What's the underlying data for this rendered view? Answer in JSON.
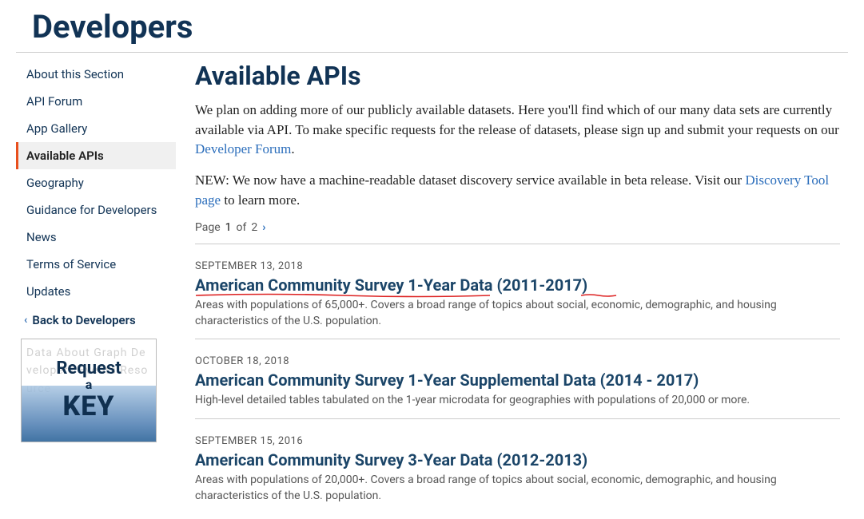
{
  "header": {
    "title": "Developers"
  },
  "sidebar": {
    "items": [
      {
        "label": "About this Section",
        "active": false
      },
      {
        "label": "API Forum",
        "active": false
      },
      {
        "label": "App Gallery",
        "active": false
      },
      {
        "label": "Available APIs",
        "active": true
      },
      {
        "label": "Geography",
        "active": false
      },
      {
        "label": "Guidance for Developers",
        "active": false
      },
      {
        "label": "News",
        "active": false
      },
      {
        "label": "Terms of Service",
        "active": false
      },
      {
        "label": "Updates",
        "active": false
      }
    ],
    "back_label": "Back to Developers",
    "key_box": {
      "line1": "Request",
      "line2": "a",
      "line3": "KEY",
      "bg_words": "Data About Graph Developers Events Resource"
    }
  },
  "main": {
    "heading": "Available APIs",
    "intro_para1_pre": "We plan on adding more of our publicly available datasets. Here you'll find which of our many data sets are currently available via API. To make specific requests for the release of datasets, please sign up and submit your requests on our ",
    "intro_para1_link": "Developer Forum",
    "intro_para1_post": ".",
    "intro_para2_pre": "NEW: We now have a machine-readable dataset discovery service available in beta release. Visit our ",
    "intro_para2_link": "Discovery Tool page",
    "intro_para2_post": " to learn more.",
    "pager": {
      "label_page": "Page",
      "current": "1",
      "label_of": "of",
      "total": "2"
    },
    "articles": [
      {
        "date": "SEPTEMBER 13, 2018",
        "title": "American Community Survey 1-Year Data (2011-2017)",
        "desc": "Areas with populations of 65,000+. Covers a broad range of topics about social, economic, demographic, and housing characteristics of the U.S. population.",
        "annotated": true
      },
      {
        "date": "OCTOBER 18, 2018",
        "title": "American Community Survey 1-Year Supplemental Data (2014 - 2017)",
        "desc": "High-level detailed tables tabulated on the 1-year microdata for geographies with populations of 20,000 or more.",
        "annotated": false
      },
      {
        "date": "SEPTEMBER 15, 2016",
        "title": "American Community Survey 3-Year Data (2012-2013)",
        "desc": "Areas with populations of 20,000+. Covers a broad range of topics about social, economic, demographic, and housing characteristics of the U.S. population.",
        "annotated": false
      }
    ]
  }
}
